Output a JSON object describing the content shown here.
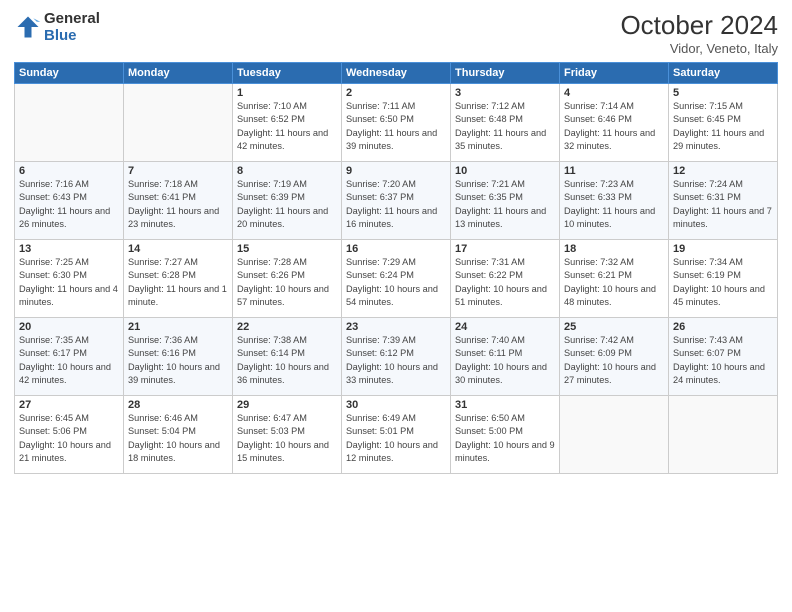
{
  "logo": {
    "general": "General",
    "blue": "Blue"
  },
  "header": {
    "month": "October 2024",
    "location": "Vidor, Veneto, Italy"
  },
  "weekdays": [
    "Sunday",
    "Monday",
    "Tuesday",
    "Wednesday",
    "Thursday",
    "Friday",
    "Saturday"
  ],
  "weeks": [
    [
      {
        "day": "",
        "sunrise": "",
        "sunset": "",
        "daylight": ""
      },
      {
        "day": "",
        "sunrise": "",
        "sunset": "",
        "daylight": ""
      },
      {
        "day": "1",
        "sunrise": "Sunrise: 7:10 AM",
        "sunset": "Sunset: 6:52 PM",
        "daylight": "Daylight: 11 hours and 42 minutes."
      },
      {
        "day": "2",
        "sunrise": "Sunrise: 7:11 AM",
        "sunset": "Sunset: 6:50 PM",
        "daylight": "Daylight: 11 hours and 39 minutes."
      },
      {
        "day": "3",
        "sunrise": "Sunrise: 7:12 AM",
        "sunset": "Sunset: 6:48 PM",
        "daylight": "Daylight: 11 hours and 35 minutes."
      },
      {
        "day": "4",
        "sunrise": "Sunrise: 7:14 AM",
        "sunset": "Sunset: 6:46 PM",
        "daylight": "Daylight: 11 hours and 32 minutes."
      },
      {
        "day": "5",
        "sunrise": "Sunrise: 7:15 AM",
        "sunset": "Sunset: 6:45 PM",
        "daylight": "Daylight: 11 hours and 29 minutes."
      }
    ],
    [
      {
        "day": "6",
        "sunrise": "Sunrise: 7:16 AM",
        "sunset": "Sunset: 6:43 PM",
        "daylight": "Daylight: 11 hours and 26 minutes."
      },
      {
        "day": "7",
        "sunrise": "Sunrise: 7:18 AM",
        "sunset": "Sunset: 6:41 PM",
        "daylight": "Daylight: 11 hours and 23 minutes."
      },
      {
        "day": "8",
        "sunrise": "Sunrise: 7:19 AM",
        "sunset": "Sunset: 6:39 PM",
        "daylight": "Daylight: 11 hours and 20 minutes."
      },
      {
        "day": "9",
        "sunrise": "Sunrise: 7:20 AM",
        "sunset": "Sunset: 6:37 PM",
        "daylight": "Daylight: 11 hours and 16 minutes."
      },
      {
        "day": "10",
        "sunrise": "Sunrise: 7:21 AM",
        "sunset": "Sunset: 6:35 PM",
        "daylight": "Daylight: 11 hours and 13 minutes."
      },
      {
        "day": "11",
        "sunrise": "Sunrise: 7:23 AM",
        "sunset": "Sunset: 6:33 PM",
        "daylight": "Daylight: 11 hours and 10 minutes."
      },
      {
        "day": "12",
        "sunrise": "Sunrise: 7:24 AM",
        "sunset": "Sunset: 6:31 PM",
        "daylight": "Daylight: 11 hours and 7 minutes."
      }
    ],
    [
      {
        "day": "13",
        "sunrise": "Sunrise: 7:25 AM",
        "sunset": "Sunset: 6:30 PM",
        "daylight": "Daylight: 11 hours and 4 minutes."
      },
      {
        "day": "14",
        "sunrise": "Sunrise: 7:27 AM",
        "sunset": "Sunset: 6:28 PM",
        "daylight": "Daylight: 11 hours and 1 minute."
      },
      {
        "day": "15",
        "sunrise": "Sunrise: 7:28 AM",
        "sunset": "Sunset: 6:26 PM",
        "daylight": "Daylight: 10 hours and 57 minutes."
      },
      {
        "day": "16",
        "sunrise": "Sunrise: 7:29 AM",
        "sunset": "Sunset: 6:24 PM",
        "daylight": "Daylight: 10 hours and 54 minutes."
      },
      {
        "day": "17",
        "sunrise": "Sunrise: 7:31 AM",
        "sunset": "Sunset: 6:22 PM",
        "daylight": "Daylight: 10 hours and 51 minutes."
      },
      {
        "day": "18",
        "sunrise": "Sunrise: 7:32 AM",
        "sunset": "Sunset: 6:21 PM",
        "daylight": "Daylight: 10 hours and 48 minutes."
      },
      {
        "day": "19",
        "sunrise": "Sunrise: 7:34 AM",
        "sunset": "Sunset: 6:19 PM",
        "daylight": "Daylight: 10 hours and 45 minutes."
      }
    ],
    [
      {
        "day": "20",
        "sunrise": "Sunrise: 7:35 AM",
        "sunset": "Sunset: 6:17 PM",
        "daylight": "Daylight: 10 hours and 42 minutes."
      },
      {
        "day": "21",
        "sunrise": "Sunrise: 7:36 AM",
        "sunset": "Sunset: 6:16 PM",
        "daylight": "Daylight: 10 hours and 39 minutes."
      },
      {
        "day": "22",
        "sunrise": "Sunrise: 7:38 AM",
        "sunset": "Sunset: 6:14 PM",
        "daylight": "Daylight: 10 hours and 36 minutes."
      },
      {
        "day": "23",
        "sunrise": "Sunrise: 7:39 AM",
        "sunset": "Sunset: 6:12 PM",
        "daylight": "Daylight: 10 hours and 33 minutes."
      },
      {
        "day": "24",
        "sunrise": "Sunrise: 7:40 AM",
        "sunset": "Sunset: 6:11 PM",
        "daylight": "Daylight: 10 hours and 30 minutes."
      },
      {
        "day": "25",
        "sunrise": "Sunrise: 7:42 AM",
        "sunset": "Sunset: 6:09 PM",
        "daylight": "Daylight: 10 hours and 27 minutes."
      },
      {
        "day": "26",
        "sunrise": "Sunrise: 7:43 AM",
        "sunset": "Sunset: 6:07 PM",
        "daylight": "Daylight: 10 hours and 24 minutes."
      }
    ],
    [
      {
        "day": "27",
        "sunrise": "Sunrise: 6:45 AM",
        "sunset": "Sunset: 5:06 PM",
        "daylight": "Daylight: 10 hours and 21 minutes."
      },
      {
        "day": "28",
        "sunrise": "Sunrise: 6:46 AM",
        "sunset": "Sunset: 5:04 PM",
        "daylight": "Daylight: 10 hours and 18 minutes."
      },
      {
        "day": "29",
        "sunrise": "Sunrise: 6:47 AM",
        "sunset": "Sunset: 5:03 PM",
        "daylight": "Daylight: 10 hours and 15 minutes."
      },
      {
        "day": "30",
        "sunrise": "Sunrise: 6:49 AM",
        "sunset": "Sunset: 5:01 PM",
        "daylight": "Daylight: 10 hours and 12 minutes."
      },
      {
        "day": "31",
        "sunrise": "Sunrise: 6:50 AM",
        "sunset": "Sunset: 5:00 PM",
        "daylight": "Daylight: 10 hours and 9 minutes."
      },
      {
        "day": "",
        "sunrise": "",
        "sunset": "",
        "daylight": ""
      },
      {
        "day": "",
        "sunrise": "",
        "sunset": "",
        "daylight": ""
      }
    ]
  ]
}
